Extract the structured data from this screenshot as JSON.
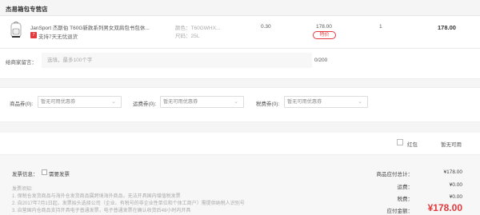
{
  "shop": {
    "name": "杰易箱包专营店"
  },
  "item": {
    "title": "JanSport 杰斯伯 T60G新款系列男女双肩包书包休...",
    "seven_day_badge": "7",
    "seven_day_text": "支持7天无忧退货",
    "color": "颜色：T60GWHX...",
    "size": "尺码：25L",
    "weight": "0.30",
    "unit_price": "178.00",
    "sale_tag": "特价",
    "quantity": "1",
    "subtotal": "178.00"
  },
  "message": {
    "label": "给商家留言：",
    "placeholder": "选填，最多100个字",
    "count": "0/200"
  },
  "coupons": {
    "shop": {
      "label": "商品券(0):",
      "value": "暂无可用优惠券"
    },
    "shipping": {
      "label": "运费券(0):",
      "value": "暂无可用优惠券"
    },
    "tax": {
      "label": "税费券(0):",
      "value": "暂无可用优惠券"
    }
  },
  "redpack": {
    "label": "红包",
    "status": "暂无可用"
  },
  "invoice": {
    "label": "发票信息：",
    "option": "需要发票"
  },
  "notes": {
    "title": "发票须知:",
    "lines": [
      "1. 保税仓发货商品与海外仓发货商品属跨境海外商品，无法开具国内增值税发票",
      "2. 自2017年7月1日起，发票抬头选择公司（企业、有税号的非企业性单位和个体工商户）需提供纳税人识别号",
      "3. 自营国内仓商品支持开具电子普通发票，电子普通发票在确认收货后48小时内开具"
    ]
  },
  "summary": {
    "goods_total_label": "商品应付总计：",
    "goods_total": "¥178.00",
    "shipping_label": "运费：",
    "shipping": "¥0.00",
    "tax_label": "税费：",
    "tax": "¥0.00",
    "payable_label": "应付金额：",
    "payable": "¥178.00"
  },
  "colors": {
    "accent": "#e4393c"
  }
}
